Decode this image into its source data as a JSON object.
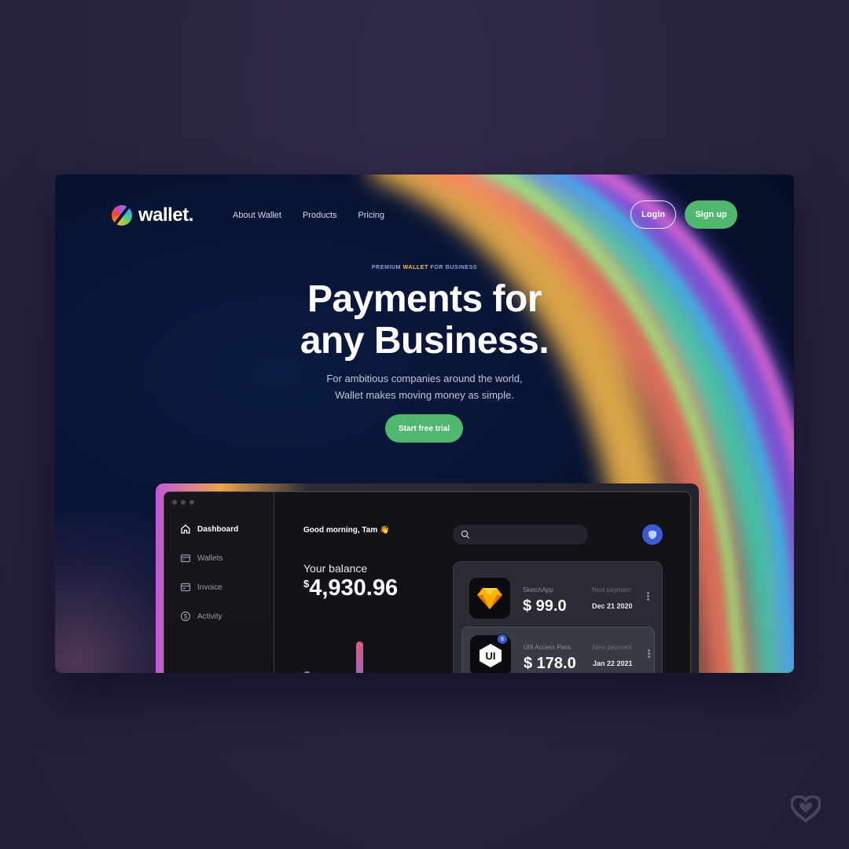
{
  "brand": {
    "name": "wallet."
  },
  "nav": {
    "items": [
      "About Wallet",
      "Products",
      "Pricing"
    ]
  },
  "auth": {
    "login": "Login",
    "signup": "Sign up"
  },
  "hero": {
    "eyebrow_prefix": "PREMIUM ",
    "eyebrow_highlight": "WALLET",
    "eyebrow_suffix": " FOR BUSINESS",
    "headline_line1": "Payments for",
    "headline_line2": "any Business.",
    "subtext_line1": "For ambitious companies around the world,",
    "subtext_line2": "Wallet makes moving money as simple.",
    "cta": "Start free trial"
  },
  "dashboard": {
    "sidebar": [
      {
        "label": "Dashboard",
        "icon": "home-icon",
        "active": true
      },
      {
        "label": "Wallets",
        "icon": "wallet-icon",
        "active": false
      },
      {
        "label": "Invoice",
        "icon": "invoice-icon",
        "active": false
      },
      {
        "label": "Activity",
        "icon": "dollar-circle-icon",
        "active": false
      }
    ],
    "greeting": "Good morning, Tam 👋",
    "balance_label": "Your balance",
    "balance_currency": "$",
    "balance_value": "4,930.96",
    "bar_colors": [
      "#d86fd0",
      "#b9e24a",
      "#e3577c"
    ],
    "subscriptions": [
      {
        "app": "SketchApp",
        "amount": "$ 99.0",
        "next_label": "Next payment",
        "next_date": "Dec 21 2020",
        "icon": "sketch-diamond-icon"
      },
      {
        "app": "UI8 Access Pass",
        "amount": "$ 178.0",
        "next_label": "Next payment",
        "next_date": "Jan 22 2021",
        "icon": "ui8-logo-icon",
        "badge": "8"
      }
    ]
  },
  "colors": {
    "accent_green": "#4fb86e",
    "background": "#2a2440",
    "frame": "#07122f"
  }
}
